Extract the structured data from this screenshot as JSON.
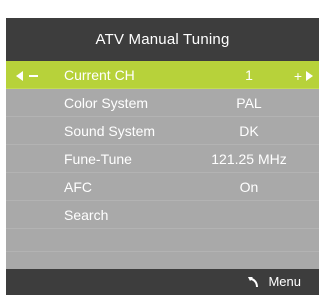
{
  "window": {
    "title": "ATV Manual Tuning"
  },
  "menu": {
    "items": [
      {
        "label": "Current CH",
        "value": "1",
        "selected": true
      },
      {
        "label": "Color System",
        "value": "PAL"
      },
      {
        "label": "Sound System",
        "value": "DK"
      },
      {
        "label": "Fune-Tune",
        "value": "121.25 MHz"
      },
      {
        "label": "AFC",
        "value": "On"
      },
      {
        "label": "Search",
        "value": ""
      }
    ]
  },
  "footer": {
    "menu_label": "Menu",
    "icon": "return-icon"
  },
  "colors": {
    "panel_bg": "#a9a9a9",
    "title_bg": "#3d3d3d",
    "selected_bg": "#b7d23a",
    "text": "#ffffff"
  }
}
